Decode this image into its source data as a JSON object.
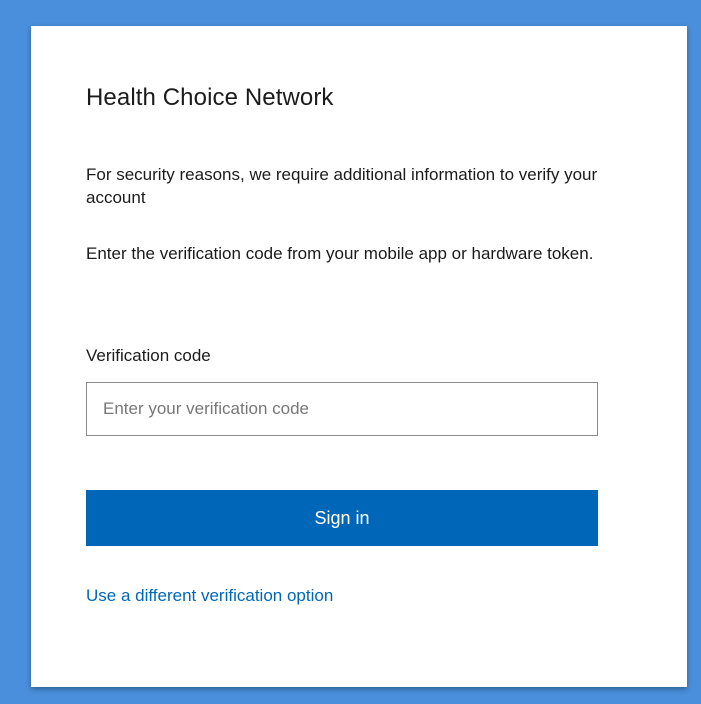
{
  "colors": {
    "background": "#4a8fdb",
    "card": "#ffffff",
    "accent": "#0067b8",
    "text": "#1b1b1b"
  },
  "card": {
    "title": "Health Choice Network",
    "security_message": "For security reasons, we require additional information to verify your account",
    "instruction": "Enter the verification code from your mobile app or hardware token."
  },
  "form": {
    "code_label": "Verification code",
    "code_value": "",
    "code_placeholder": "Enter your verification code",
    "submit_label": "Sign in",
    "alt_option_label": "Use a different verification option"
  }
}
